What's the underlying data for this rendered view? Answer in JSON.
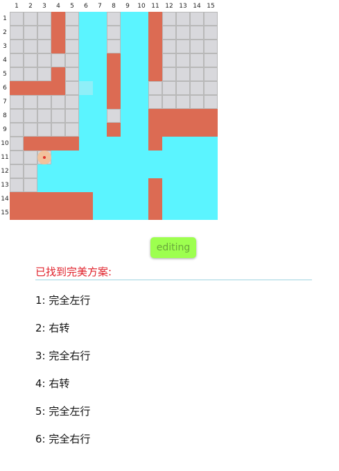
{
  "grid": {
    "columns": [
      "1",
      "2",
      "3",
      "4",
      "5",
      "6",
      "7",
      "8",
      "9",
      "10",
      "11",
      "12",
      "13",
      "14",
      "15"
    ],
    "rows": [
      "1",
      "2",
      "3",
      "4",
      "5",
      "6",
      "7",
      "8",
      "9",
      "10",
      "11",
      "12",
      "13",
      "14",
      "15"
    ],
    "legend": {
      "W": "gray wall",
      "R": "red block",
      "C": "open water",
      "H": "highlighted cell"
    },
    "cells": [
      "WWWRWCCWCCRWWWW",
      "WWWRWCCWCCRWWWW",
      "WWWRWCCWCCRWWWW",
      "WWWWWCCRCCRWWWW",
      "WWWRWCCRCCRWWWW",
      "RRRRWHCRCCWWWWW",
      "WWWWWCCRCCWWWWW",
      "WWWWWCCWCCRRRRR",
      "WWWWWCCRCCRRRRR",
      "WRRRRCCCCCRCCCC",
      "WWWCCCCCCCCCCCC",
      "WWCCCCCCCCCCCCC",
      "WWCCCCCCCCRCCCC",
      "RRRRRRCCCCRCCCC",
      "RRRRRRCCCCRCCCC"
    ],
    "marker": {
      "row": 11,
      "col": 3
    }
  },
  "colors": {
    "wall": "#d8d8dc",
    "wall_border": "#b8b8b8",
    "red": "#dc6b53",
    "water": "#5bf4ff",
    "highlight": "#8feff8",
    "marker": "#f2c29c",
    "marker_dot": "#e2342c",
    "button": "#9dff4f",
    "title": "#e0202a"
  },
  "toolbar": {
    "editing_label": "editing"
  },
  "result": {
    "title": "已找到完美方案:",
    "steps": [
      "1: 完全左行",
      "2: 右转",
      "3: 完全右行",
      "4: 右转",
      "5: 完全左行",
      "6: 完全右行"
    ]
  }
}
